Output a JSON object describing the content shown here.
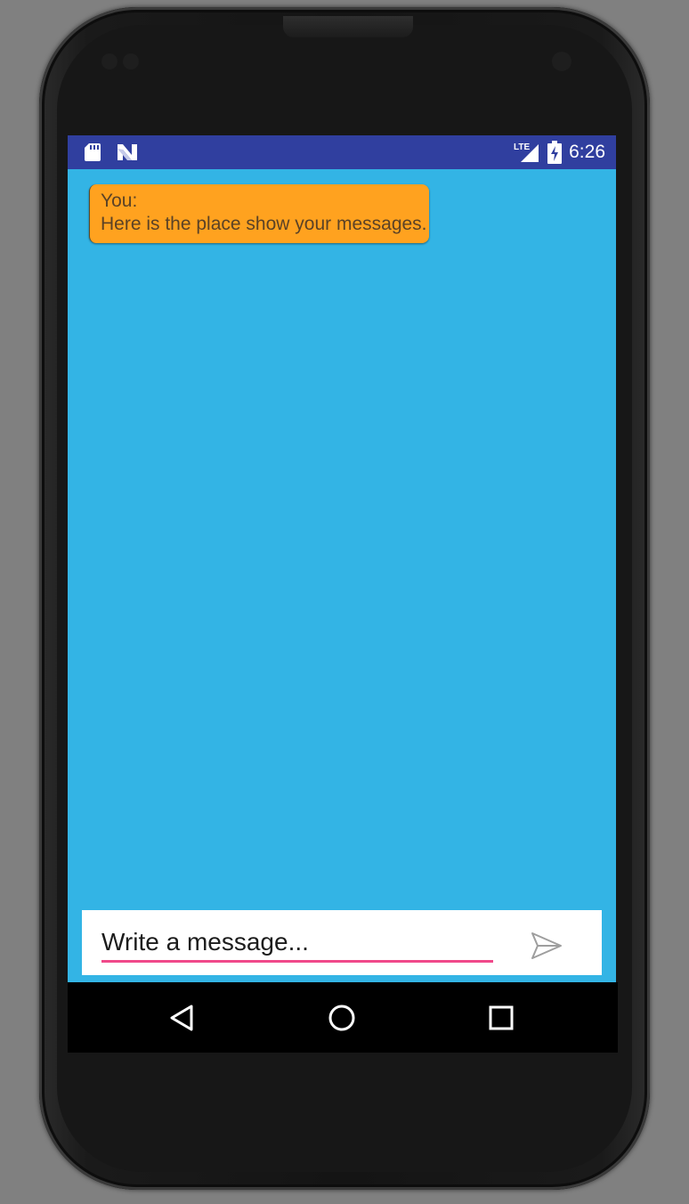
{
  "status_bar": {
    "time": "6:26",
    "network_label": "LTE",
    "icons": [
      "sd-card-icon",
      "android-n-icon",
      "lte-signal-icon",
      "battery-charging-icon"
    ]
  },
  "chat": {
    "messages": [
      {
        "sender": "You:",
        "text": "Here is the place show your messages."
      }
    ]
  },
  "composer": {
    "placeholder": "Write a message...",
    "value": "",
    "send_icon": "send-icon"
  },
  "nav": {
    "icons": [
      "back-icon",
      "home-icon",
      "recents-icon"
    ]
  },
  "colors": {
    "status_bar": "#303f9f",
    "chat_background": "#33b4e5",
    "bubble": "#ffa21f",
    "input_underline": "#f0498a",
    "nav_bar": "#000000"
  }
}
